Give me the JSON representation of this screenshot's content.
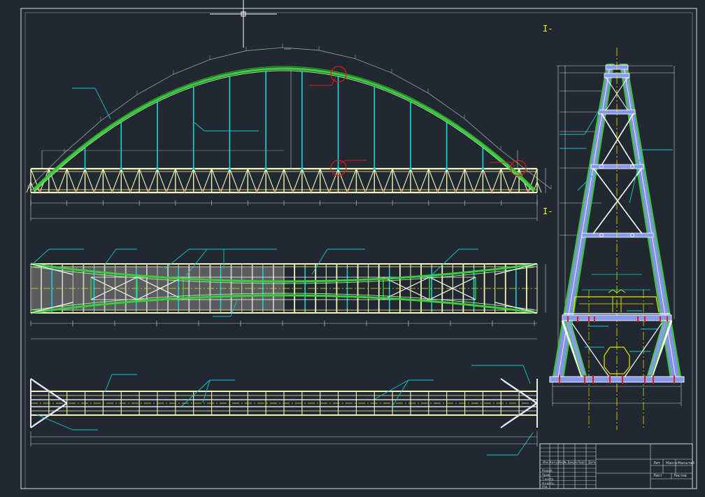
{
  "drawing": {
    "section_marks": [
      "I-",
      "I-"
    ],
    "title_block": {
      "row_headers": [
        "Изм.",
        "Кол.уч",
        "Лист",
        "№ Докум.",
        "Подп.",
        "Дата"
      ],
      "col_headers": [
        "Лит",
        "Масса",
        "Масштаб"
      ],
      "sheet_labels": [
        "Лист",
        "Листов"
      ],
      "roles": [
        "Разраб.",
        "Пров.",
        "Т.контр.",
        "Н.контр.",
        "Утв."
      ]
    }
  },
  "colors": {
    "background": "#212830",
    "frame": "#d8dde2",
    "truss": "#f2f4b8",
    "arch": "#3ccc3c",
    "hanger": "#18d6de",
    "leader": "#18c8d0",
    "dimension": "#c8ccd0",
    "callout": "#e01818",
    "axis": "#e6e600",
    "gusset": "#8899ee"
  },
  "icons": {
    "crosshair": "cad-cursor-crosshair-icon",
    "detail_callout": "detail-callout-circle-icon"
  }
}
